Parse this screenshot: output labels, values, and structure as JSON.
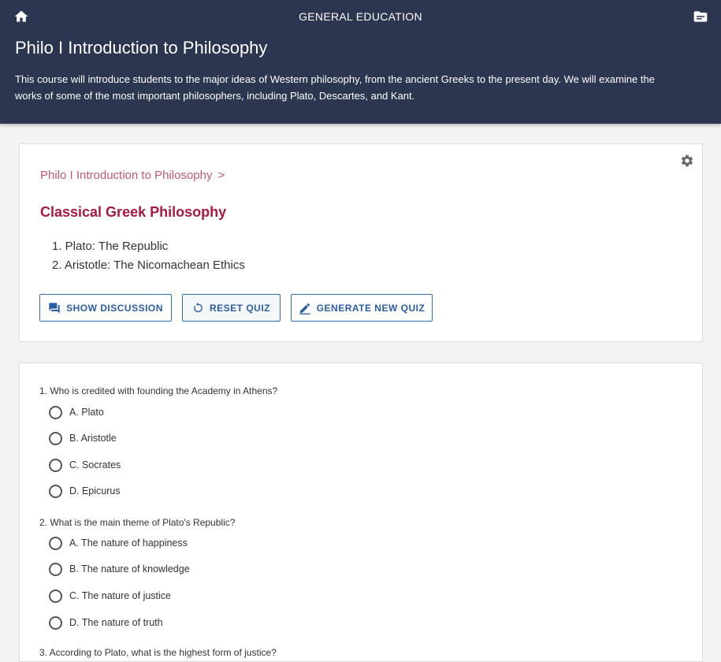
{
  "header": {
    "app_title": "GENERAL EDUCATION",
    "course_title": "Philo I Introduction to Philosophy",
    "course_description": "This course will introduce students to the major ideas of Western philosophy, from the ancient Greeks to the present day. We will examine the works of some of the most important philosophers, including Plato, Descartes, and Kant."
  },
  "lesson": {
    "breadcrumb": "Philo I Introduction to Philosophy",
    "breadcrumb_separator": ">",
    "section_title": "Classical Greek Philosophy",
    "readings": [
      "1. Plato: The Republic",
      "2. Aristotle: The Nicomachean Ethics"
    ],
    "buttons": {
      "discussion": "SHOW DISCUSSION",
      "reset": "RESET QUIZ",
      "generate": "GENERATE NEW QUIZ"
    }
  },
  "quiz": {
    "questions": [
      {
        "text": "1. Who is credited with founding the Academy in Athens?",
        "options": [
          "A. Plato",
          "B. Aristotle",
          "C. Socrates",
          "D. Epicurus"
        ]
      },
      {
        "text": "2. What is the main theme of Plato's Republic?",
        "options": [
          "A. The nature of happiness",
          "B. The nature of knowledge",
          "C. The nature of justice",
          "D. The nature of truth"
        ]
      },
      {
        "text": "3. According to Plato, what is the highest form of justice?",
        "options": []
      }
    ]
  },
  "colors": {
    "header_bg": "#2c3650",
    "accent": "#a8183f",
    "breadcrumb": "#c05a72",
    "button": "#2a5d9f"
  },
  "icons": {
    "home": "home-icon",
    "folder": "folder-icon",
    "settings": "gear-icon",
    "discussion": "forum-icon",
    "reset": "reset-icon",
    "generate": "edit-icon"
  }
}
